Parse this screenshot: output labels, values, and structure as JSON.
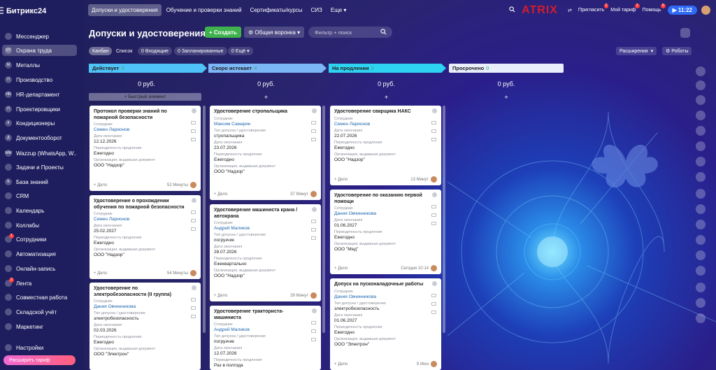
{
  "app": {
    "logo": "Битрикс24",
    "brand": "ATRIX"
  },
  "sidebar": {
    "items": [
      {
        "label": "Мессенджер",
        "icon": "chat-icon"
      },
      {
        "label": "Охрана труда",
        "icon": "text-badge-icon",
        "short": "ОТ"
      },
      {
        "label": "Металлы",
        "icon": "text-badge-icon",
        "short": "М"
      },
      {
        "label": "Производство",
        "icon": "text-badge-icon",
        "short": "П"
      },
      {
        "label": "HR-департамент",
        "icon": "text-badge-icon",
        "short": "HR"
      },
      {
        "label": "Проектировщики",
        "icon": "text-badge-icon",
        "short": "П"
      },
      {
        "label": "Кондиционеры",
        "icon": "text-badge-icon",
        "short": "К"
      },
      {
        "label": "Документооборот",
        "icon": "text-badge-icon",
        "short": "Д"
      },
      {
        "label": "Wazzup (WhatsApp, W...",
        "icon": "text-badge-icon",
        "short": "WW"
      },
      {
        "label": "Задачи и Проекты",
        "icon": "tasks-icon"
      },
      {
        "label": "База знаний",
        "icon": "text-badge-icon",
        "short": "Б"
      },
      {
        "label": "CRM",
        "icon": "crm-icon"
      },
      {
        "label": "Календарь",
        "icon": "calendar-icon"
      },
      {
        "label": "Коллабы",
        "icon": "collab-icon"
      },
      {
        "label": "Сотрудники",
        "icon": "people-icon",
        "badge": "1"
      },
      {
        "label": "Автоматизация",
        "icon": "automation-icon"
      },
      {
        "label": "Онлайн-запись",
        "icon": "booking-icon"
      },
      {
        "label": "Лента",
        "icon": "feed-icon",
        "badge": "2"
      },
      {
        "label": "Совместная работа",
        "icon": "collab-work-icon"
      },
      {
        "label": "Складской учёт",
        "icon": "warehouse-icon"
      },
      {
        "label": "Маркетинг",
        "icon": "marketing-icon"
      },
      {
        "label": "Настройки",
        "icon": "gear-icon"
      }
    ],
    "upgrade": "Расширить тариф"
  },
  "topbar": {
    "tabs": [
      "Допуски и удостоверения",
      "Обучение и проверки знаний",
      "Сертификаты/курсы",
      "СИЗ",
      "Еще"
    ],
    "invite": "Пригласить",
    "invite_badge": "1",
    "tariff": "Мой тариф",
    "tariff_badge": "1",
    "help": "Помощь",
    "help_badge": "5",
    "clock": "11:22"
  },
  "header": {
    "title": "Допуски и удостоверения",
    "create": "Создать",
    "funnel": "Общая воронка",
    "search_placeholder": "Фильтр + поиск",
    "views": [
      "Канбан",
      "Список"
    ],
    "filters": [
      {
        "label": "Входящие",
        "count": "0"
      },
      {
        "label": "Запланированные",
        "count": "0"
      },
      {
        "label": "Ещё",
        "count": "0"
      }
    ],
    "extensions": "Расширения",
    "robots": "Роботы"
  },
  "columns": [
    {
      "name": "Действует",
      "count": "3",
      "color": "#4fc3f7",
      "sum": "0 руб.",
      "quick": "Быстрый элемент"
    },
    {
      "name": "Скоро истекает",
      "count": "4",
      "color": "#7bb7f6",
      "sum": "0 руб.",
      "sum_highlight": "0"
    },
    {
      "name": "На продлении",
      "count": "3",
      "color": "#2fd3f2",
      "sum": "0 руб."
    },
    {
      "name": "Просрочено",
      "count": "0",
      "color": "#e8eefc",
      "sum": "0 руб."
    }
  ],
  "labels": {
    "employee": "Сотрудник",
    "expiry": "Дата окончания",
    "period": "Периодичность продления",
    "org": "Организация, выдавшая документ",
    "type": "Тип допуска / удостоверения",
    "deal": "+ Дело"
  },
  "cards": {
    "c1": {
      "title": "Протокол проверки знаний по пожарной безопасности",
      "employee": "Семен Ларионов",
      "expiry": "12.12.2026",
      "period": "Ежегодно",
      "org": "ООО \"Надзор\"",
      "time": "52 Минуты"
    },
    "c2": {
      "title": "Удостоверение о прохождении обучения по пожарной безопасности",
      "employee": "Семен Ларионов",
      "expiry": "25.02.2027",
      "period": "Ежегодно",
      "org": "ООО \"Надзор\"",
      "time": "54 Минуты"
    },
    "c3": {
      "title": "Удостоверение по электробезопасности (II группа)",
      "employee": "Дания Овчинникова",
      "type": "электробезопасность",
      "expiry": "02.03.2026",
      "period": "Ежегодно",
      "org": "ООО \"Электрон\""
    },
    "c4": {
      "title": "Удостоверение стропальщика",
      "employee": "Максим Самарин",
      "type": "стропальщика",
      "expiry": "23.07.2026",
      "period": "Ежегодно",
      "org": "ООО \"Надзор\"",
      "time": "37 Минут"
    },
    "c5": {
      "title": "Удостоверение машиниста крана / автокрана",
      "employee": "Андрей Маликов",
      "type": "погрузчик",
      "expiry": "28.07.2026",
      "period": "Ежеквартально",
      "org": "ООО \"Надзор\"",
      "time": "39 Минут"
    },
    "c6": {
      "title": "Удостоверение тракториста-машиниста",
      "employee": "Андрей Маликов",
      "type": "погрузчик",
      "expiry": "12.07.2026",
      "period": "Раз в полгода"
    },
    "c7": {
      "title": "Удостоверение сварщика НАКС",
      "employee": "Семен Ларионов",
      "expiry": "22.07.2026",
      "period": "Ежегодно",
      "org": "ООО \"Надзор\"",
      "time": "13 Минут"
    },
    "c8": {
      "title": "Удостоверение по оказанию первой помощи",
      "employee": "Дания Овчинникова",
      "expiry": "01.06.2027",
      "period": "Ежегодно",
      "org": "ООО \"Мед\"",
      "time": "Сегодня 10:14"
    },
    "c9": {
      "title": "Допуск на пусконаладочные работы",
      "employee": "Дания Овчинникова",
      "type": "электробезопасность",
      "expiry": "01.06.2027",
      "period": "Ежегодно",
      "org": "ООО \"Электрон\"",
      "time": "9 Июн"
    }
  }
}
